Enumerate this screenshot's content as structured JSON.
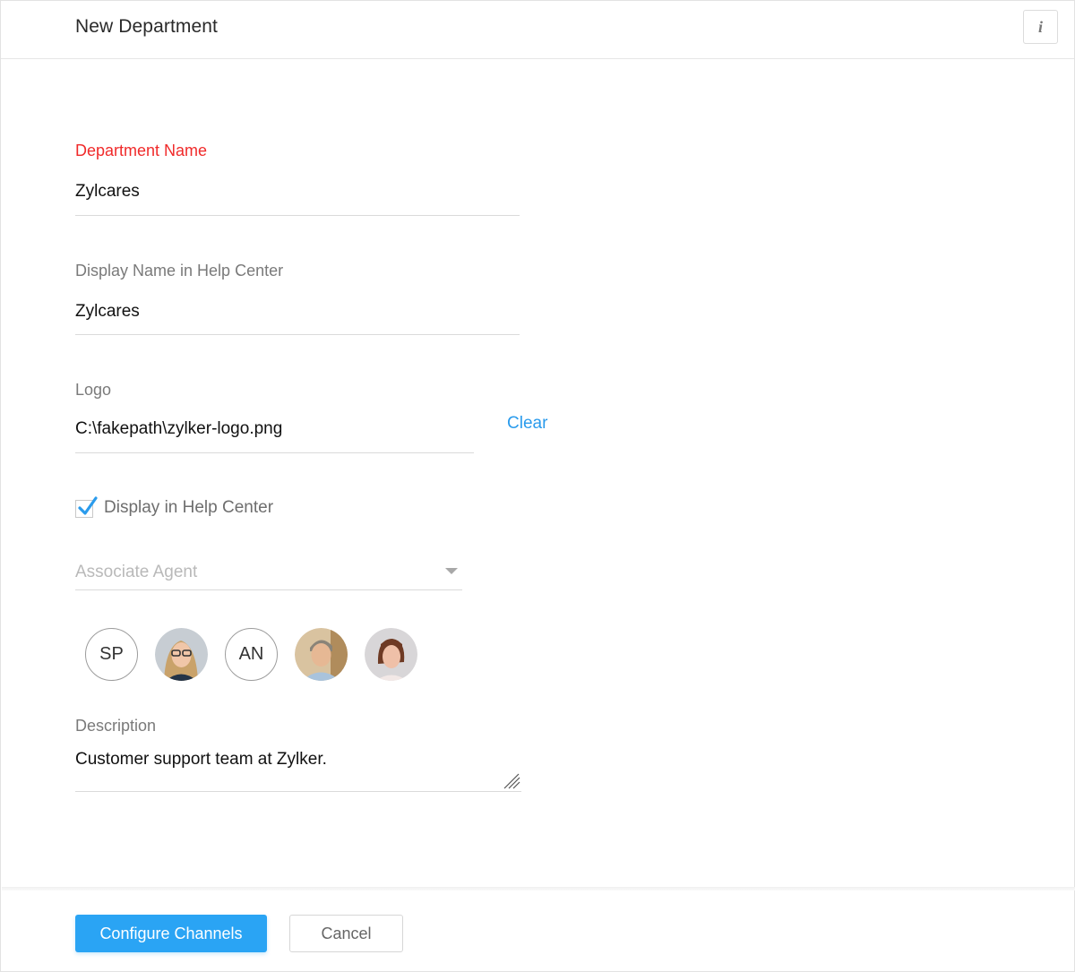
{
  "header": {
    "title": "New Department",
    "info_icon": "info-icon",
    "info_glyph": "i"
  },
  "form": {
    "department_name": {
      "label": "Department Name",
      "value": "Zylcares",
      "required": true
    },
    "display_name": {
      "label": "Display Name in Help Center",
      "value": "Zylcares"
    },
    "logo": {
      "label": "Logo",
      "value": "C:\\fakepath\\zylker-logo.png",
      "clear_label": "Clear"
    },
    "display_in_help_center": {
      "label": "Display in Help Center",
      "checked": true
    },
    "associate_agent": {
      "placeholder": "Associate Agent",
      "icon": "chevron-down-icon"
    },
    "agents": [
      {
        "type": "initials",
        "text": "SP"
      },
      {
        "type": "photo",
        "icon": "agent-photo-woman-glasses"
      },
      {
        "type": "initials",
        "text": "AN"
      },
      {
        "type": "photo",
        "icon": "agent-photo-man-smiling"
      },
      {
        "type": "photo",
        "icon": "agent-photo-woman-short-hair"
      }
    ],
    "description": {
      "label": "Description",
      "value": "Customer support team at Zylker."
    }
  },
  "footer": {
    "primary_label": "Configure Channels",
    "secondary_label": "Cancel"
  },
  "colors": {
    "accent": "#2aa4f4",
    "link": "#2a9bec",
    "required_label": "#f02a2a",
    "checkmark": "#2a9bec"
  }
}
